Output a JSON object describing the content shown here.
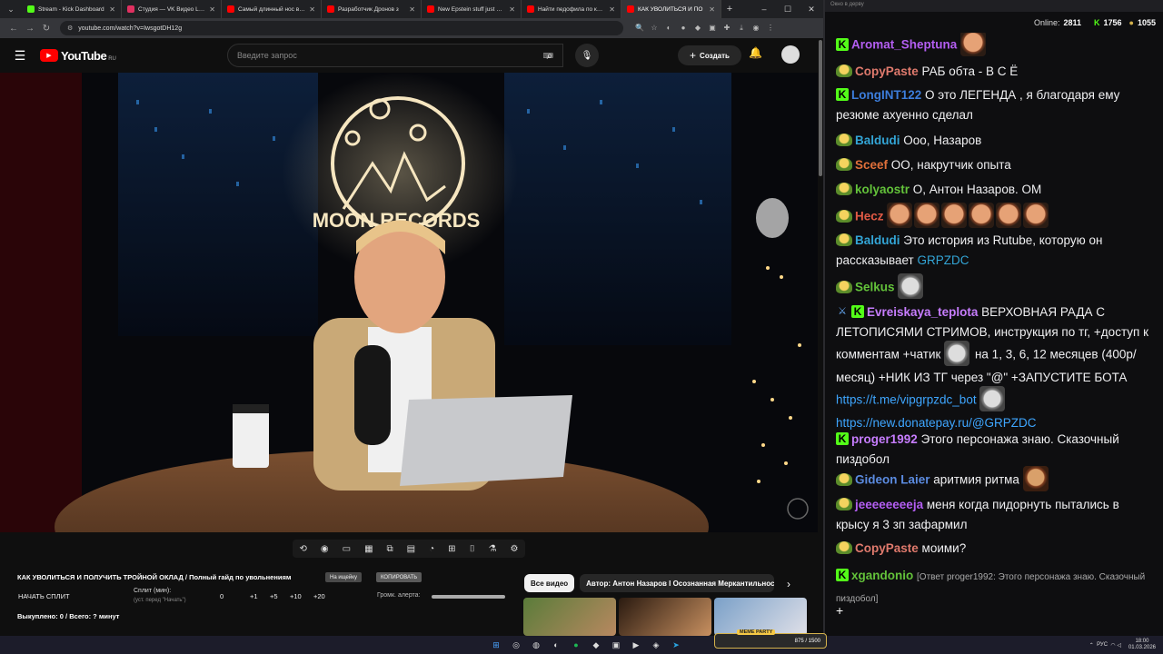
{
  "browser": {
    "tabs": [
      {
        "label": "Stream - Kick Dashboard",
        "color": "#53fc18"
      },
      {
        "label": "Студия — VK Видео Live",
        "color": "#e03060"
      },
      {
        "label": "Самый длинный нос в ист",
        "color": "#ff0000"
      },
      {
        "label": "Разработчик Дронов з",
        "color": "#ff0000"
      },
      {
        "label": "New Epstein stuff just dropp",
        "color": "#ff0000"
      },
      {
        "label": "Найти педофила по кирп",
        "color": "#ff0000"
      },
      {
        "label": "КАК УВОЛИТЬСЯ И ПО",
        "color": "#ff0000",
        "active": true
      }
    ],
    "url": "youtube.com/watch?v=IwsgotDH12g"
  },
  "youtube": {
    "logo": "YouTube",
    "region": "RU",
    "search_placeholder": "Введите запрос",
    "create_label": "Создать"
  },
  "video": {
    "title": "КАК УВОЛИТЬСЯ И ПОЛУЧИТЬ ТРОЙНОЙ ОКЛАД / Полный гайд по увольнениям",
    "neon_text": "MOON RECORDS",
    "tag1": "На ищейку",
    "tag2": "КОПИРОВАТЬ"
  },
  "split": {
    "start_label": "НАЧАТЬ СПЛИТ",
    "split_label": "Сплит (мин):",
    "split_sub": "(уст. перед \"Начать\")",
    "value": "0",
    "inc1": "+1",
    "inc5": "+5",
    "inc10": "+10",
    "inc20": "+20",
    "alert_label": "Громк. алерта:",
    "paid": "Выкуплено: 0 / Всего: ? минут"
  },
  "chips": [
    "Все видео",
    "Автор: Антон Назаров I Осознанная Меркантильность"
  ],
  "chat": {
    "header": "Окно в дерву",
    "online_label": "Online:",
    "online": "2811",
    "kick_count": "1756",
    "gold_count": "1055",
    "messages": [
      {
        "badges": [
          "kick"
        ],
        "user": "Aromat_Sheptuna",
        "color": "#b35ef2",
        "text": "",
        "emotes": [
          "face"
        ]
      },
      {
        "badges": [
          "pack"
        ],
        "user": "CopyPaste",
        "color": "#e07a6d",
        "text": "РАБ обта - В С Ё"
      },
      {
        "badges": [
          "kick"
        ],
        "user": "LongINT122",
        "color": "#3c7ddb",
        "text": "О это ЛЕГЕНДА , я благодаря ему резюме ахуенно сделал"
      },
      {
        "badges": [
          "pack"
        ],
        "user": "Baldudi",
        "color": "#33a5d6",
        "text": "Ооо, Назаров"
      },
      {
        "badges": [
          "pack"
        ],
        "user": "Sceef",
        "color": "#e0703a",
        "text": "ОО, накрутчик опыта"
      },
      {
        "badges": [
          "pack"
        ],
        "user": "kolyaostr",
        "color": "#63c23a",
        "text": "О, Антон Назаров. ОМ"
      },
      {
        "badges": [
          "pack"
        ],
        "user": "Hecz",
        "color": "#e05a45",
        "text": "",
        "emotes": [
          "face",
          "face",
          "face",
          "face",
          "face",
          "face"
        ]
      },
      {
        "badges": [
          "pack"
        ],
        "user": "Baldudi",
        "color": "#33a5d6",
        "text": "Это история из Rutube, которую он рассказывает",
        "mention": "GRPZDC"
      },
      {
        "badges": [
          "pack"
        ],
        "user": "Selkus",
        "color": "#63c23a",
        "text": "",
        "emotes": [
          "cat"
        ]
      },
      {
        "badges": [
          "sword",
          "kick"
        ],
        "user": "Evreiskaya_teplota",
        "color": "#c77dff",
        "text": "ВЕРХОВНАЯ РАДА С ЛЕТОПИСЯМИ СТРИМОВ, инструкция по тг, +доступ к комментам +чатик",
        "text2": "на 1, 3, 6, 12 месяцев (400р/месяц) +НИК ИЗ ТГ через \"@\" +ЗАПУСТИТЕ БОТА",
        "link1": "https://t.me/vipgrpzdc_bot",
        "link2": "https://new.donatepay.ru/@GRPZDC"
      },
      {
        "badges": [
          "kick"
        ],
        "user": "proger1992",
        "color": "#c77dff",
        "text": "Этого персонажа знаю. Сказочный пиздобол"
      },
      {
        "badges": [
          "pack"
        ],
        "user": "Gideon Laier",
        "color": "#5b8be0",
        "text": "аритмия ритма",
        "emotes": [
          "man"
        ]
      },
      {
        "badges": [
          "pack"
        ],
        "user": "jeeeeeeeeja",
        "color": "#b35ef2",
        "text": "меня когда пидорнуть пытались в крысу я 3 зп зафармил"
      },
      {
        "badges": [
          "pack"
        ],
        "user": "CopyPaste",
        "color": "#e07a6d",
        "text": "моими?"
      },
      {
        "badges": [
          "kick"
        ],
        "user": "xgandonio",
        "color": "#63c23a",
        "reply": "[Ответ proger1992: Этого персонажа знаю. Сказочный пиздобол]"
      }
    ]
  },
  "taskbar": {
    "lang": "РУС",
    "time": "18:00",
    "date": "01.03.2026",
    "meme_label": "MEME PARTY",
    "meme_value": "875 / 1500"
  }
}
